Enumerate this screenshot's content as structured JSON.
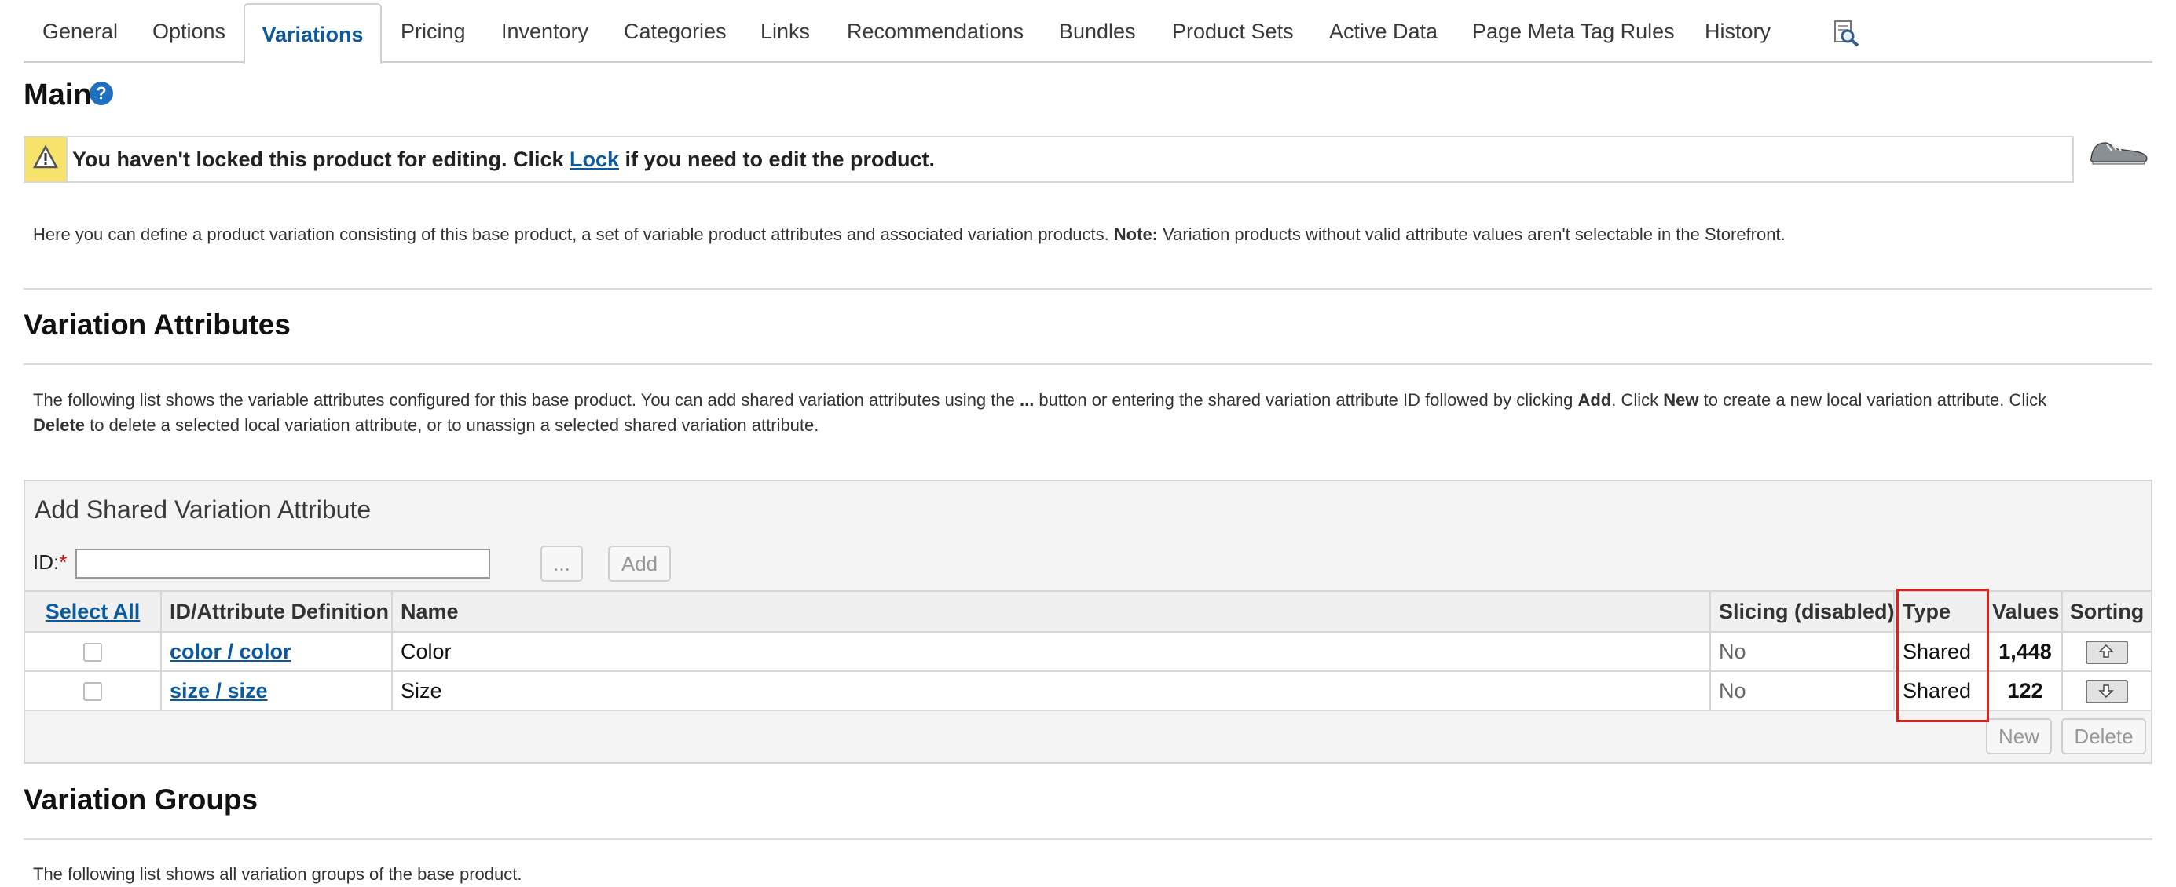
{
  "tabs": [
    {
      "label": "General"
    },
    {
      "label": "Options"
    },
    {
      "label": "Variations"
    },
    {
      "label": "Pricing"
    },
    {
      "label": "Inventory"
    },
    {
      "label": "Categories"
    },
    {
      "label": "Links"
    },
    {
      "label": "Recommendations"
    },
    {
      "label": "Bundles"
    },
    {
      "label": "Product Sets"
    },
    {
      "label": "Active Data"
    },
    {
      "label": "Page Meta Tag Rules"
    },
    {
      "label": "History"
    }
  ],
  "active_tab": "Variations",
  "main": {
    "title": "Main",
    "lock_notice": {
      "before": "You haven't locked this product for editing. Click ",
      "link": "Lock",
      "after": " if you need to edit the product."
    },
    "description": {
      "text": "Here you can define a product variation consisting of this base product, a set of variable product attributes and associated variation products. ",
      "note_label": "Note:",
      "note_text": " Variation products without valid attribute values aren't selectable in the Storefront."
    }
  },
  "variation_attributes": {
    "title": "Variation Attributes",
    "desc_line1": {
      "a": "The following list shows the variable attributes configured for this base product. You can add shared variation attributes using the ",
      "b": "...",
      "c": " button or entering the shared variation attribute ID followed by clicking ",
      "d": "Add",
      "e": ". Click ",
      "f": "New",
      "g": " to create a new local variation attribute. Click"
    },
    "desc_line2": {
      "a": "Delete",
      "b": " to delete a selected local variation attribute, or to unassign a selected shared variation attribute."
    },
    "add_panel": {
      "title": "Add Shared Variation Attribute",
      "id_label": "ID:",
      "required_mark": "*",
      "id_value": "",
      "browse_label": "...",
      "add_label": "Add"
    },
    "columns": {
      "select_all": "Select All",
      "id": "ID/Attribute Definition",
      "name": "Name",
      "slicing": "Slicing (disabled)",
      "type": "Type",
      "values": "Values",
      "sorting": "Sorting"
    },
    "rows": [
      {
        "id": "color / color",
        "name": "Color",
        "slicing": "No",
        "type": "Shared",
        "values": "1,448",
        "sort": "up"
      },
      {
        "id": "size / size",
        "name": "Size",
        "slicing": "No",
        "type": "Shared",
        "values": "122",
        "sort": "down"
      }
    ],
    "new_label": "New",
    "delete_label": "Delete"
  },
  "variation_groups": {
    "title": "Variation Groups",
    "description": "The following list shows all variation groups of the base product."
  },
  "colors": {
    "link": "#0b5aa0",
    "warning_bg": "#f5e36b",
    "highlight": "#e0201a"
  },
  "icons": {
    "help": "question-circle-icon",
    "warning": "warning-triangle-icon",
    "product_image": "shoe-thumbnail",
    "search_preview": "magnifier-page-icon",
    "sort_up": "arrow-up-icon",
    "sort_down": "arrow-down-icon"
  }
}
